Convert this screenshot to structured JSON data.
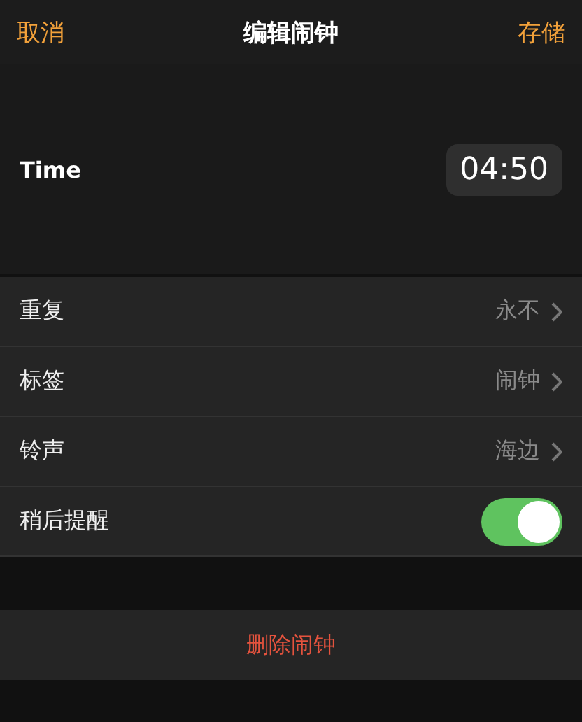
{
  "nav": {
    "cancel": "取消",
    "title": "编辑闹钟",
    "save": "存储"
  },
  "time": {
    "label": "Time",
    "value": "04:50"
  },
  "rows": [
    {
      "kind": "link",
      "label": "重复",
      "value": "永不"
    },
    {
      "kind": "link",
      "label": "标签",
      "value": "闹钟"
    },
    {
      "kind": "link",
      "label": "铃声",
      "value": "海边"
    },
    {
      "kind": "toggle",
      "label": "稍后提醒",
      "on": true
    }
  ],
  "delete": "删除闹钟"
}
